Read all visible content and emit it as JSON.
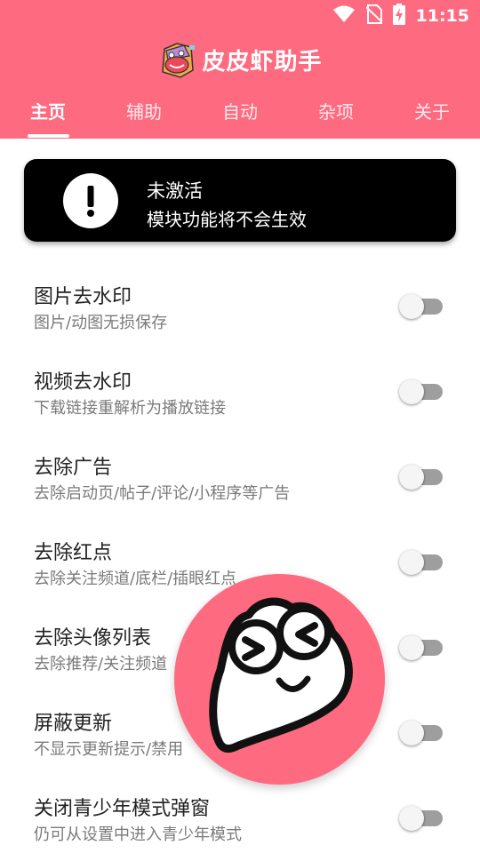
{
  "status_bar": {
    "time": "11:15",
    "icons": [
      "wifi-icon",
      "no-sim-icon",
      "battery-charging-icon"
    ]
  },
  "app": {
    "title": "皮皮虾助手",
    "logo": "pipixia-logo"
  },
  "tabs": [
    {
      "label": "主页",
      "active": true
    },
    {
      "label": "辅助",
      "active": false
    },
    {
      "label": "自动",
      "active": false
    },
    {
      "label": "杂项",
      "active": false
    },
    {
      "label": "关于",
      "active": false
    }
  ],
  "warning": {
    "icon": "alert-icon",
    "title": "未激活",
    "subtitle": "模块功能将不会生效"
  },
  "settings": [
    {
      "title": "图片去水印",
      "desc": "图片/动图无损保存",
      "enabled": false
    },
    {
      "title": "视频去水印",
      "desc": "下载链接重解析为播放链接",
      "enabled": false
    },
    {
      "title": "去除广告",
      "desc": "去除启动页/帖子/评论/小程序等广告",
      "enabled": false
    },
    {
      "title": "去除红点",
      "desc": "去除关注频道/底栏/插眼红点",
      "enabled": false
    },
    {
      "title": "去除头像列表",
      "desc": "去除推荐/关注频道",
      "enabled": false
    },
    {
      "title": "屏蔽更新",
      "desc": "不显示更新提示/禁用",
      "enabled": false
    },
    {
      "title": "关闭青少年模式弹窗",
      "desc": "仍可从设置中进入青少年模式",
      "enabled": false
    }
  ],
  "fab": {
    "icon": "pipixia-face-icon"
  },
  "colors": {
    "accent": "#fe6b80",
    "card_bg": "#000000",
    "switch_track_off": "#9e9e9e",
    "switch_thumb_off": "#f5f5f5"
  }
}
